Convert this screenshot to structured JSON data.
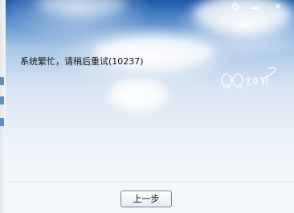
{
  "dialog": {
    "message": "系统繁忙，请稍后重试(10237)",
    "back_button_label": "上一步",
    "signature_text": "QQ2013"
  },
  "titlebar": {
    "gear_icon": "gear-icon",
    "minimize_icon": "minimize-icon",
    "close_icon": "close-icon",
    "close_glyph": "✕"
  },
  "colors": {
    "sky_top": "#1e5aa8",
    "sky_bottom": "#f2f6fa",
    "text": "#111111"
  }
}
